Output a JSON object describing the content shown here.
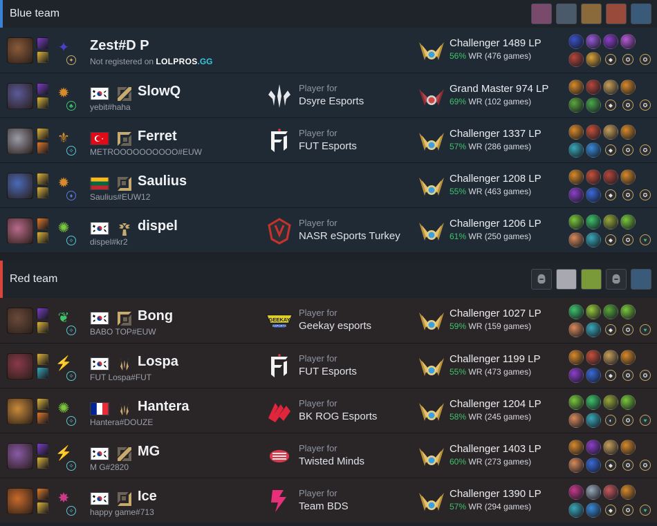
{
  "blue_team": {
    "title": "Blue team",
    "accent": "#3b82d6",
    "bans": [
      {
        "icon": "champion-ban-icon",
        "color": "#7a4a6c"
      },
      {
        "icon": "champion-ban-icon",
        "color": "#4b5a6a"
      },
      {
        "icon": "champion-ban-icon",
        "color": "#8a6a3a"
      },
      {
        "icon": "champion-ban-icon",
        "color": "#9a4a3a"
      },
      {
        "icon": "champion-ban-icon",
        "color": "#3a5a7a"
      }
    ],
    "players": [
      {
        "name": "Zest#D P",
        "riot_id": "Not registered on",
        "logo_a": "LOLPROS",
        "logo_b": ".GG",
        "registered": false,
        "flag": null,
        "role": "none",
        "champion_color": "#8a5a3a",
        "spells": [
          "#7a3ec2",
          "#e0b53a"
        ],
        "keystone": {
          "glyph": "✦",
          "color": "#4b3ec9"
        },
        "subrune": {
          "glyph": "✦",
          "color": "#c8aa6e"
        },
        "team_prefix": "",
        "team_name": "",
        "team_logo": "none",
        "rank": "Challenger 1489 LP",
        "rank_tier": "challenger",
        "wr_pct": "56%",
        "wr_rest": "WR (476 games)",
        "runes": [
          "#3b52c9",
          "#9a5ad8",
          "#8e3ec9",
          "#b85ad8",
          "#b8473b",
          "#d9a23a"
        ],
        "shards": [
          "◆",
          "✪",
          "✪"
        ]
      },
      {
        "name": "SlowQ",
        "riot_id": "yebit#haha",
        "registered": true,
        "flag": "kr",
        "role": "mid",
        "champion_color": "#5a5a9a",
        "spells": [
          "#7a3ec2",
          "#e0b53a"
        ],
        "keystone": {
          "glyph": "✹",
          "color": "#d98a2a"
        },
        "subrune": {
          "glyph": "♣",
          "color": "#3fc36b"
        },
        "team_prefix": "Player for",
        "team_name": "Dsyre Esports",
        "team_logo": "dsyre",
        "rank": "Grand Master 974 LP",
        "rank_tier": "grandmaster",
        "wr_pct": "69%",
        "wr_rest": "WR (102 games)",
        "runes": [
          "#d98a2a",
          "#b8473b",
          "#c9a05a",
          "#d98a2a",
          "#5aa83b",
          "#4aa84a"
        ],
        "shards": [
          "◆",
          "✪",
          "✪"
        ]
      },
      {
        "name": "Ferret",
        "riot_id": "METROOOOOOOOOO#EUW",
        "registered": true,
        "flag": "tr",
        "role": "top",
        "champion_color": "#9a9aa8",
        "spells": [
          "#e0b53a",
          "#e07a2a"
        ],
        "keystone": {
          "glyph": "⚜",
          "color": "#d98a2a"
        },
        "subrune": {
          "glyph": "✧",
          "color": "#5ac8d8"
        },
        "team_prefix": "Player for",
        "team_name": "FUT Esports",
        "team_logo": "fut",
        "rank": "Challenger 1337 LP",
        "rank_tier": "challenger",
        "wr_pct": "57%",
        "wr_rest": "WR (286 games)",
        "runes": [
          "#d98a2a",
          "#c9503a",
          "#c9a05a",
          "#d98a2a",
          "#3aa8b8",
          "#3a8ad8"
        ],
        "shards": [
          "◆",
          "✪",
          "✪"
        ]
      },
      {
        "name": "Saulius",
        "riot_id": "Saulius#EUW12",
        "registered": true,
        "flag": "lt",
        "role": "bot",
        "champion_color": "#4a6ab8",
        "spells": [
          "#e0b53a",
          "#e0b53a"
        ],
        "keystone": {
          "glyph": "✹",
          "color": "#d98a2a"
        },
        "subrune": {
          "glyph": "♦",
          "color": "#5a7ad8"
        },
        "team_prefix": "",
        "team_name": "",
        "team_logo": "none",
        "rank": "Challenger 1208 LP",
        "rank_tier": "challenger",
        "wr_pct": "55%",
        "wr_rest": "WR (463 games)",
        "runes": [
          "#d98a2a",
          "#c9503a",
          "#b8473b",
          "#d98a2a",
          "#8e3ec9",
          "#3a6ad8"
        ],
        "shards": [
          "◆",
          "✪",
          "✪"
        ]
      },
      {
        "name": "dispel",
        "riot_id": "dispel#kr2",
        "registered": true,
        "flag": "kr",
        "role": "support",
        "champion_color": "#b86a8a",
        "spells": [
          "#e07a2a",
          "#e0b53a"
        ],
        "keystone": {
          "glyph": "✺",
          "color": "#7ac83b"
        },
        "subrune": {
          "glyph": "✧",
          "color": "#5ac8d8"
        },
        "team_prefix": "Player for",
        "team_name": "NASR eSports Turkey",
        "team_logo": "nasr",
        "rank": "Challenger 1206 LP",
        "rank_tier": "challenger",
        "wr_pct": "61%",
        "wr_rest": "WR (250 games)",
        "runes": [
          "#7ac83b",
          "#3fc36b",
          "#9aa83b",
          "#7ac83b",
          "#d98a5a",
          "#3aa8b8"
        ],
        "shards": [
          "◆",
          "✪",
          "♥"
        ]
      }
    ]
  },
  "red_team": {
    "title": "Red team",
    "accent": "#d9453b",
    "bans": [
      {
        "icon": "empty-ban-icon",
        "color": "#2a2d33"
      },
      {
        "icon": "champion-ban-icon",
        "color": "#a8a8b0"
      },
      {
        "icon": "champion-ban-icon",
        "color": "#7a9a3a"
      },
      {
        "icon": "empty-ban-icon",
        "color": "#2a2d33"
      },
      {
        "icon": "champion-ban-icon",
        "color": "#3a5a7a"
      }
    ],
    "players": [
      {
        "name": "Bong",
        "riot_id": "BABO TOP#EUW",
        "registered": true,
        "flag": "kr",
        "role": "top",
        "champion_color": "#6a4a3a",
        "spells": [
          "#7a3ec2",
          "#e0b53a"
        ],
        "keystone": {
          "glyph": "❦",
          "color": "#3fc36b"
        },
        "subrune": {
          "glyph": "✧",
          "color": "#5ac8d8"
        },
        "team_prefix": "Player for",
        "team_name": "Geekay esports",
        "team_logo": "geekay",
        "rank": "Challenger 1027 LP",
        "rank_tier": "challenger",
        "wr_pct": "59%",
        "wr_rest": "WR (159 games)",
        "runes": [
          "#3fc36b",
          "#9ac83b",
          "#5aa83b",
          "#7ac83b",
          "#d98a5a",
          "#3aa8b8"
        ],
        "shards": [
          "◆",
          "✪",
          "♥"
        ]
      },
      {
        "name": "Lospa",
        "riot_id": "FUT Lospa#FUT",
        "registered": true,
        "flag": "kr",
        "role": "jungle",
        "champion_color": "#8a3a4a",
        "spells": [
          "#e0b53a",
          "#3aa8b8"
        ],
        "keystone": {
          "glyph": "⚡",
          "color": "#d98a2a"
        },
        "subrune": {
          "glyph": "✧",
          "color": "#5ac8d8"
        },
        "team_prefix": "Player for",
        "team_name": "FUT Esports",
        "team_logo": "fut",
        "rank": "Challenger 1199 LP",
        "rank_tier": "challenger",
        "wr_pct": "55%",
        "wr_rest": "WR (473 games)",
        "runes": [
          "#d98a2a",
          "#c9503a",
          "#c9a05a",
          "#d98a2a",
          "#8e3ec9",
          "#3a6ad8"
        ],
        "shards": [
          "◆",
          "✪",
          "✪"
        ]
      },
      {
        "name": "Hantera",
        "riot_id": "Hantera#DOUZE",
        "registered": true,
        "flag": "fr",
        "role": "jungle",
        "champion_color": "#c98a3a",
        "spells": [
          "#e0b53a",
          "#e07a2a"
        ],
        "keystone": {
          "glyph": "✺",
          "color": "#7ac83b"
        },
        "subrune": {
          "glyph": "✧",
          "color": "#5ac8d8"
        },
        "team_prefix": "Player for",
        "team_name": "BK ROG Esports",
        "team_logo": "bkrog",
        "rank": "Challenger 1204 LP",
        "rank_tier": "challenger",
        "wr_pct": "58%",
        "wr_rest": "WR (245 games)",
        "runes": [
          "#7ac83b",
          "#3fc36b",
          "#9aa83b",
          "#7ac83b",
          "#d98a5a",
          "#3aa8b8"
        ],
        "shards": [
          "◐",
          "✪",
          "♥"
        ]
      },
      {
        "name": "MG",
        "riot_id": "M G#2820",
        "registered": true,
        "flag": "kr",
        "role": "mid",
        "champion_color": "#8a5aa8",
        "spells": [
          "#7a3ec2",
          "#e0b53a"
        ],
        "keystone": {
          "glyph": "⚡",
          "color": "#d98a2a"
        },
        "subrune": {
          "glyph": "✧",
          "color": "#5ac8d8"
        },
        "team_prefix": "Player for",
        "team_name": "Twisted Minds",
        "team_logo": "twisted",
        "rank": "Challenger 1403 LP",
        "rank_tier": "challenger",
        "wr_pct": "60%",
        "wr_rest": "WR (273 games)",
        "runes": [
          "#d98a2a",
          "#8e3ec9",
          "#c9a05a",
          "#d98a2a",
          "#d98a5a",
          "#3a6ad8"
        ],
        "shards": [
          "◆",
          "✪",
          "✪"
        ]
      },
      {
        "name": "Ice",
        "riot_id": "happy game#713",
        "registered": true,
        "flag": "kr",
        "role": "bot",
        "champion_color": "#c96a2a",
        "spells": [
          "#e07a2a",
          "#e0b53a"
        ],
        "keystone": {
          "glyph": "✸",
          "color": "#c93a8a"
        },
        "subrune": {
          "glyph": "✧",
          "color": "#5ac8d8"
        },
        "team_prefix": "Player for",
        "team_name": "Team BDS",
        "team_logo": "bds",
        "rank": "Challenger 1390 LP",
        "rank_tier": "challenger",
        "wr_pct": "57%",
        "wr_rest": "WR (294 games)",
        "runes": [
          "#c93a8a",
          "#9aa8b8",
          "#c95a5a",
          "#d98a2a",
          "#3aa8b8",
          "#3a8ad8"
        ],
        "shards": [
          "◆",
          "✪",
          "♥"
        ]
      }
    ]
  }
}
